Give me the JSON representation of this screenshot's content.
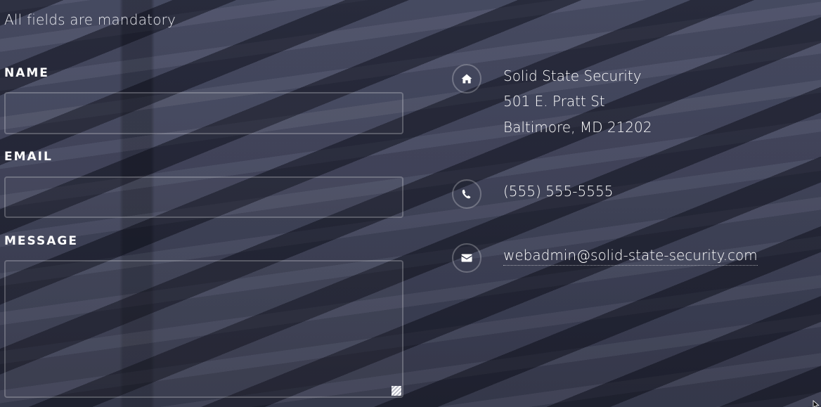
{
  "form": {
    "mandatory_note": "All fields are mandatory",
    "name_label": "NAME",
    "email_label": "EMAIL",
    "message_label": "MESSAGE",
    "name_value": "",
    "email_value": "",
    "message_value": ""
  },
  "contact": {
    "address": {
      "icon": "home-icon",
      "line1": "Solid State Security",
      "line2": "501 E. Pratt St",
      "line3": "Baltimore, MD 21202"
    },
    "phone": {
      "icon": "phone-icon",
      "number": "(555) 555-5555"
    },
    "email": {
      "icon": "envelope-icon",
      "address": "webadmin@solid-state-security.com"
    }
  }
}
